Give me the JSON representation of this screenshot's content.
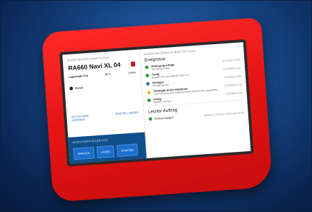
{
  "left": {
    "section_label": "ROBOTERINFORMATIONEN",
    "robot_name": "RA660 Navi XL 04",
    "location": "Lagerhalle Ost",
    "battery": "68 %",
    "connection": "online",
    "status": "Bereit",
    "link_screen_lock": "BILDSCHIRM SPERREN",
    "link_settings": "EINSTELLUNGEN"
  },
  "control": {
    "section_label": "ROBOTERSTEUERUNG",
    "buttons": [
      "SERVICE",
      "LADEN",
      "STARTEN"
    ]
  },
  "right": {
    "section_label": "ROBOTER BERICHTERSTATTUNG",
    "events_title": "Ereignisse",
    "events": [
      {
        "title": "Reinigung erfolgt",
        "subtitle": "Reinigung erfolgt",
        "time": "17.08.2021 13:24",
        "status": "success"
      },
      {
        "title": "Fertig",
        "subtitle": "Bereitet sich auf nächste Fahrt vor",
        "time": "17.08.2021 13:15",
        "status": "success"
      },
      {
        "title": "Reinigen",
        "subtitle": "Reinigt Bereich",
        "time": "17.08.2021 12:56",
        "status": "info"
      },
      {
        "title": "Gestoppt durch Hindernis",
        "subtitle": "Das Fahrzeug wird aufgrund eines Hindernisses angehalten",
        "time": "17.08.2021 12:37",
        "status": "warning"
      },
      {
        "title": "Fertig",
        "subtitle": "Bereitet sich vor",
        "time": "17.08.2021 12:29",
        "status": "success"
      }
    ],
    "last_title": "Letzter Auftrag",
    "last_job": {
      "title": "Scheuersaugen",
      "meta": "Beendet 17.08.2021 13:24 Dauer 00:32",
      "status": "success"
    }
  },
  "colors": {
    "device_red": "#e41414",
    "panel_blue": "#0f4f8c",
    "button_blue": "#1b6fcf",
    "success": "#2e9d3a",
    "info": "#1d6fc4",
    "warning": "#f0a000"
  }
}
